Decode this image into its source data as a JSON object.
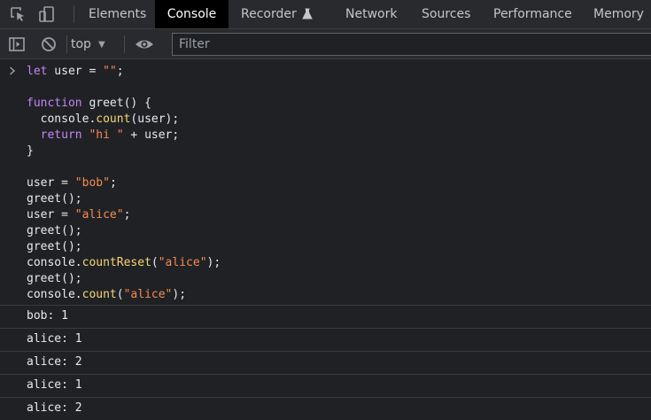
{
  "tabs": [
    {
      "label": "Elements",
      "active": false
    },
    {
      "label": "Console",
      "active": true
    },
    {
      "label": "Recorder",
      "active": false
    },
    {
      "label": "Network",
      "active": false
    },
    {
      "label": "Sources",
      "active": false
    },
    {
      "label": "Performance",
      "active": false
    },
    {
      "label": "Memory",
      "active": false
    }
  ],
  "toolbar": {
    "context": "top",
    "filter_placeholder": "Filter"
  },
  "code": {
    "line1": {
      "kw": "let",
      "rest": " user = ",
      "str": "\"\"",
      "end": ";"
    },
    "line3": {
      "kw": "function",
      "rest": " greet() {"
    },
    "line4": {
      "pre": "  console.",
      "method": "count",
      "end": "(user);"
    },
    "line5": {
      "pre": "  ",
      "kw": "return",
      "space": " ",
      "str": "\"hi \"",
      "end": " + user;"
    },
    "line6": "}",
    "line8": {
      "pre": "user = ",
      "str": "\"bob\"",
      "end": ";"
    },
    "line9": "greet();",
    "line10": {
      "pre": "user = ",
      "str": "\"alice\"",
      "end": ";"
    },
    "line11": "greet();",
    "line12": "greet();",
    "line13": {
      "pre": "console.",
      "method": "countReset",
      "open": "(",
      "str": "\"alice\"",
      "end": ");"
    },
    "line14": "greet();",
    "line15": {
      "pre": "console.",
      "method": "count",
      "open": "(",
      "str": "\"alice\"",
      "end": ");"
    }
  },
  "output": [
    "bob: 1",
    "alice: 1",
    "alice: 2",
    "alice: 1",
    "alice: 2"
  ],
  "colors": {
    "background": "#202124",
    "keyword": "#c586f7",
    "string": "#f28b54",
    "method": "#f7d678"
  }
}
